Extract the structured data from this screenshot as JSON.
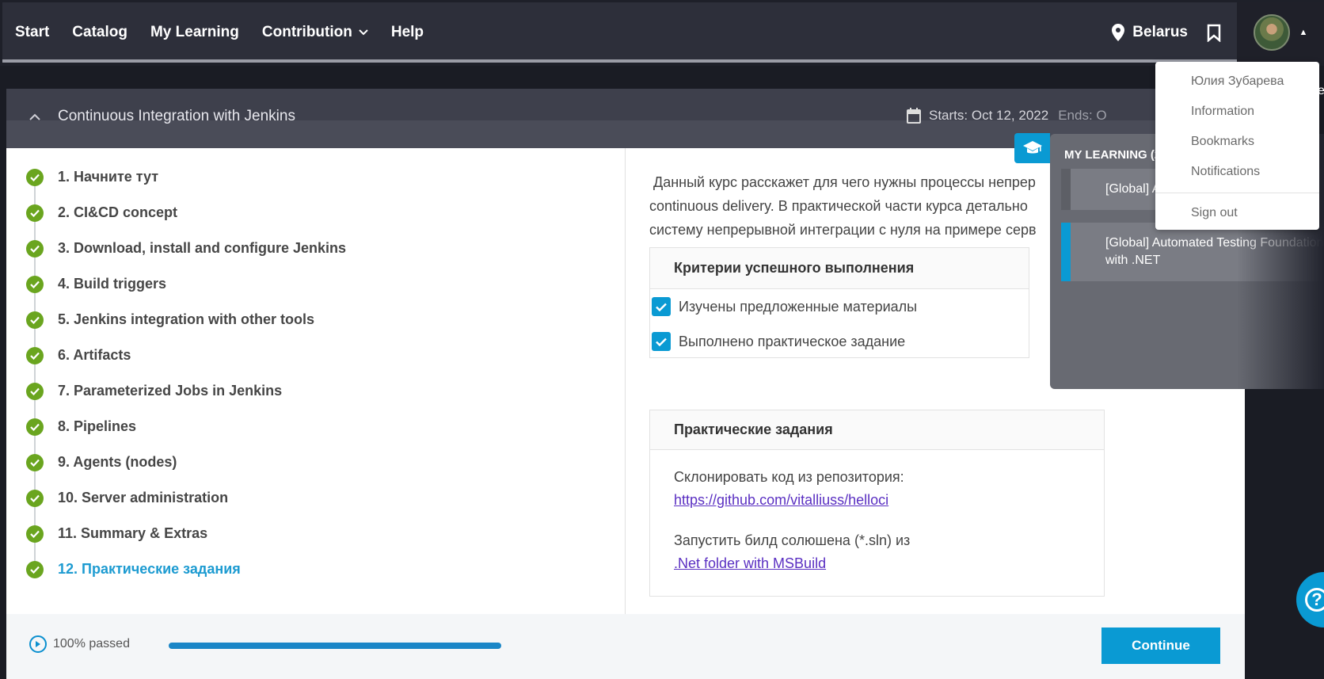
{
  "nav": {
    "items": [
      "Start",
      "Catalog",
      "My Learning",
      "Contribution",
      "Help"
    ],
    "location": "Belarus"
  },
  "course": {
    "title": "Continuous Integration with Jenkins",
    "starts": "Starts: Oct 12, 2022",
    "ends": "Ends: O"
  },
  "lessons": [
    {
      "label": "1. Начните тут"
    },
    {
      "label": "2. CI&CD concept"
    },
    {
      "label": "3. Download, install and configure Jenkins"
    },
    {
      "label": "4. Build triggers"
    },
    {
      "label": "5. Jenkins integration with other tools"
    },
    {
      "label": "6. Artifacts"
    },
    {
      "label": "7. Parameterized Jobs in Jenkins"
    },
    {
      "label": "8. Pipelines"
    },
    {
      "label": "9. Agents (nodes)"
    },
    {
      "label": "10. Server administration"
    },
    {
      "label": "11. Summary & Extras"
    },
    {
      "label": "12. Практические задания"
    }
  ],
  "description": {
    "line1": " Данный курс расскажет для чего нужны процессы непрер",
    "line2": "continuous delivery. В практической части курса детально",
    "line3": "систему непрерывной интеграции с нуля на примере серв"
  },
  "criteria": {
    "header": "Критерии успешного выполнения",
    "items": [
      "Изучены предложенные материалы",
      "Выполнено практическое задание"
    ]
  },
  "tasks": {
    "header": "Практические задания",
    "clone_text": "Склонировать код из репозитория:",
    "clone_link": "https://github.com/vitalliuss/helloci",
    "build_text": "Запустить билд солюшена (*.sln) из",
    "build_link": ".Net folder with MSBuild"
  },
  "footer": {
    "passed": "100% passed",
    "progress": 1.0,
    "continue": "Continue"
  },
  "my_learning": {
    "title": "MY LEARNING (2",
    "items": [
      "[Global] A",
      "[Global] Automated Testing Foundation with .NET"
    ]
  },
  "user_menu": {
    "name": "Юлия Зубарева",
    "items": [
      "Information",
      "Bookmarks",
      "Notifications"
    ],
    "signout": "Sign out"
  },
  "stray": "e",
  "colors": {
    "accent": "#0a9ad3",
    "done": "#6aa51f",
    "topbar": "#2d2f3a"
  }
}
